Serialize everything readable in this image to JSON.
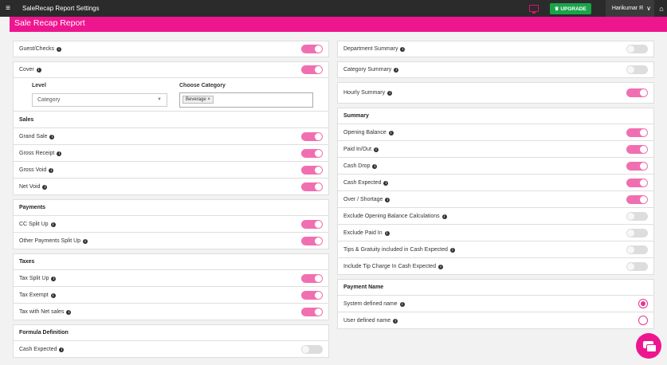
{
  "topbar": {
    "menu_glyph": "≡",
    "title": "SaleRecap Report Settings",
    "upgrade_label": "UPGRADE",
    "user_name": "Harikumar R",
    "chevron": "∨",
    "home_glyph": "⌂"
  },
  "band": {
    "title": "Sale Recap Report"
  },
  "left": {
    "guest_checks": "Guest/Checks",
    "cover": "Cover",
    "level_label": "Level",
    "level_value": "Category",
    "choose_category_label": "Choose Category",
    "chip": "Beverage",
    "sales_header": "Sales",
    "sales_rows": [
      "Grand Sale",
      "Gross Receipt",
      "Gross Void",
      "Net Void"
    ],
    "payments_header": "Payments",
    "payments_rows": [
      "CC Split Up",
      "Other Payments Split Up"
    ],
    "taxes_header": "Taxes",
    "taxes_rows": [
      "Tax Split Up",
      "Tax Exempt",
      "Tax with Net sales"
    ],
    "formula_header": "Formula Definition",
    "formula_rows": [
      "Cash Expected"
    ]
  },
  "right": {
    "department_summary": "Department Summary",
    "category_summary": "Category Summary",
    "hourly_summary": "Hourly Summary",
    "summary_header": "Summary",
    "summary_rows": [
      "Opening Balance",
      "Paid In/Out",
      "Cash Drop",
      "Cash Expected",
      "Over / Shortage",
      "Exclude Opening Balance Calculations",
      "Exclude Paid In",
      "Tips & Gratuity included in Cash Expected",
      "Include Tip Charge In Cash Expected"
    ],
    "payment_name_header": "Payment Name",
    "payment_name_rows": [
      "System defined name",
      "User defined name"
    ]
  },
  "colors": {
    "accent": "#ee168f",
    "toggle_on": "#f06fb1",
    "upgrade": "#1aa44a",
    "topbar": "#2b2b2b"
  },
  "toggles": {
    "guest_checks": true,
    "cover": true,
    "grand_sale": true,
    "gross_receipt": true,
    "gross_void": true,
    "net_void": true,
    "cc_split_up": true,
    "other_payments_split_up": true,
    "tax_split_up": true,
    "tax_exempt": true,
    "tax_with_net_sales": true,
    "cash_expected_formula": false,
    "department_summary": false,
    "category_summary": false,
    "hourly_summary": true,
    "opening_balance": true,
    "paid_in_out": true,
    "cash_drop": true,
    "cash_expected": true,
    "over_shortage": true,
    "exclude_opening_balance": false,
    "exclude_paid_in": false,
    "tips_gratuity": false,
    "include_tip_charge": false
  },
  "payment_name_selected": "System defined name",
  "icons": [
    "menu-icon",
    "tv-icon",
    "chevron-down-icon",
    "home-icon",
    "info-icon",
    "chat-icon"
  ]
}
